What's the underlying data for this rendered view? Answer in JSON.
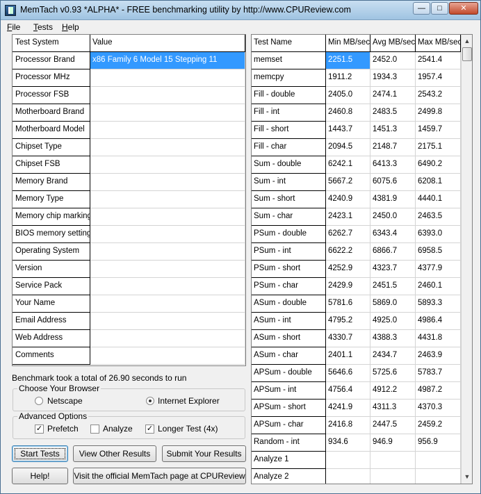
{
  "window": {
    "title": "MemTach v0.93 *ALPHA* - FREE benchmarking utility by http://www.CPUReview.com",
    "min_glyph": "—",
    "max_glyph": "□",
    "close_glyph": "✕"
  },
  "menu": [
    {
      "accel": "F",
      "rest": "ile"
    },
    {
      "accel": "T",
      "rest": "ests"
    },
    {
      "accel": "H",
      "rest": "elp"
    }
  ],
  "system_grid": {
    "headers": [
      "Test System",
      "Value"
    ],
    "rows": [
      {
        "name": "Processor Brand",
        "value": "x86 Family 6 Model 15 Stepping 11",
        "selected": true
      },
      {
        "name": "Processor MHz",
        "value": ""
      },
      {
        "name": "Processor FSB",
        "value": ""
      },
      {
        "name": "Motherboard Brand",
        "value": ""
      },
      {
        "name": "Motherboard Model",
        "value": ""
      },
      {
        "name": "Chipset Type",
        "value": ""
      },
      {
        "name": "Chipset FSB",
        "value": ""
      },
      {
        "name": "Memory Brand",
        "value": ""
      },
      {
        "name": "Memory Type",
        "value": ""
      },
      {
        "name": "Memory chip markings",
        "value": ""
      },
      {
        "name": "BIOS memory settings",
        "value": ""
      },
      {
        "name": "Operating System",
        "value": ""
      },
      {
        "name": "Version",
        "value": ""
      },
      {
        "name": "Service Pack",
        "value": ""
      },
      {
        "name": "Your Name",
        "value": ""
      },
      {
        "name": "Email Address",
        "value": ""
      },
      {
        "name": "Web Address",
        "value": ""
      },
      {
        "name": "Comments",
        "value": ""
      }
    ]
  },
  "status_text": "Benchmark took a total of 26.90 seconds to run",
  "browser_group": {
    "title": "Choose Your Browser",
    "options": [
      "Netscape",
      "Internet Explorer"
    ],
    "selected": "Internet Explorer"
  },
  "advanced_group": {
    "title": "Advanced Options",
    "options": [
      {
        "label": "Prefetch",
        "checked": true
      },
      {
        "label": "Analyze",
        "checked": false
      },
      {
        "label": "Longer Test (4x)",
        "checked": true
      }
    ]
  },
  "buttons": {
    "start": "Start Tests",
    "view_other": "View Other Results",
    "submit": "Submit Your Results",
    "help": "Help!",
    "visit": "Visit the official MemTach page at CPUReview"
  },
  "results_grid": {
    "headers": [
      "Test Name",
      "Min MB/sec",
      "Avg MB/sec",
      "Max MB/sec"
    ],
    "rows": [
      {
        "name": "memset",
        "min": "2251.5",
        "avg": "2452.0",
        "max": "2541.4",
        "selected_min": true
      },
      {
        "name": "memcpy",
        "min": "1911.2",
        "avg": "1934.3",
        "max": "1957.4"
      },
      {
        "name": "Fill - double",
        "min": "2405.0",
        "avg": "2474.1",
        "max": "2543.2"
      },
      {
        "name": "Fill - int",
        "min": "2460.8",
        "avg": "2483.5",
        "max": "2499.8"
      },
      {
        "name": "Fill - short",
        "min": "1443.7",
        "avg": "1451.3",
        "max": "1459.7"
      },
      {
        "name": "Fill - char",
        "min": "2094.5",
        "avg": "2148.7",
        "max": "2175.1"
      },
      {
        "name": "Sum - double",
        "min": "6242.1",
        "avg": "6413.3",
        "max": "6490.2"
      },
      {
        "name": "Sum - int",
        "min": "5667.2",
        "avg": "6075.6",
        "max": "6208.1"
      },
      {
        "name": "Sum - short",
        "min": "4240.9",
        "avg": "4381.9",
        "max": "4440.1"
      },
      {
        "name": "Sum - char",
        "min": "2423.1",
        "avg": "2450.0",
        "max": "2463.5"
      },
      {
        "name": "PSum - double",
        "min": "6262.7",
        "avg": "6343.4",
        "max": "6393.0"
      },
      {
        "name": "PSum - int",
        "min": "6622.2",
        "avg": "6866.7",
        "max": "6958.5"
      },
      {
        "name": "PSum - short",
        "min": "4252.9",
        "avg": "4323.7",
        "max": "4377.9"
      },
      {
        "name": "PSum - char",
        "min": "2429.9",
        "avg": "2451.5",
        "max": "2460.1"
      },
      {
        "name": "ASum - double",
        "min": "5781.6",
        "avg": "5869.0",
        "max": "5893.3"
      },
      {
        "name": "ASum - int",
        "min": "4795.2",
        "avg": "4925.0",
        "max": "4986.4"
      },
      {
        "name": "ASum - short",
        "min": "4330.7",
        "avg": "4388.3",
        "max": "4431.8"
      },
      {
        "name": "ASum - char",
        "min": "2401.1",
        "avg": "2434.7",
        "max": "2463.9"
      },
      {
        "name": "APSum - double",
        "min": "5646.6",
        "avg": "5725.6",
        "max": "5783.7"
      },
      {
        "name": "APSum - int",
        "min": "4756.4",
        "avg": "4912.2",
        "max": "4987.2"
      },
      {
        "name": "APSum - short",
        "min": "4241.9",
        "avg": "4311.3",
        "max": "4370.3"
      },
      {
        "name": "APSum - char",
        "min": "2416.8",
        "avg": "2447.5",
        "max": "2459.2"
      },
      {
        "name": "Random - int",
        "min": "934.6",
        "avg": "946.9",
        "max": "956.9"
      },
      {
        "name": "Analyze 1",
        "min": "",
        "avg": "",
        "max": ""
      },
      {
        "name": "Analyze 2",
        "min": "",
        "avg": "",
        "max": ""
      }
    ]
  },
  "colors": {
    "selection": "#3399ff",
    "title_gradient_top": "#c9dff1",
    "close_button": "#c24a2c"
  },
  "icons": {
    "scroll_up": "▲",
    "scroll_down": "▼",
    "check": "✓"
  }
}
